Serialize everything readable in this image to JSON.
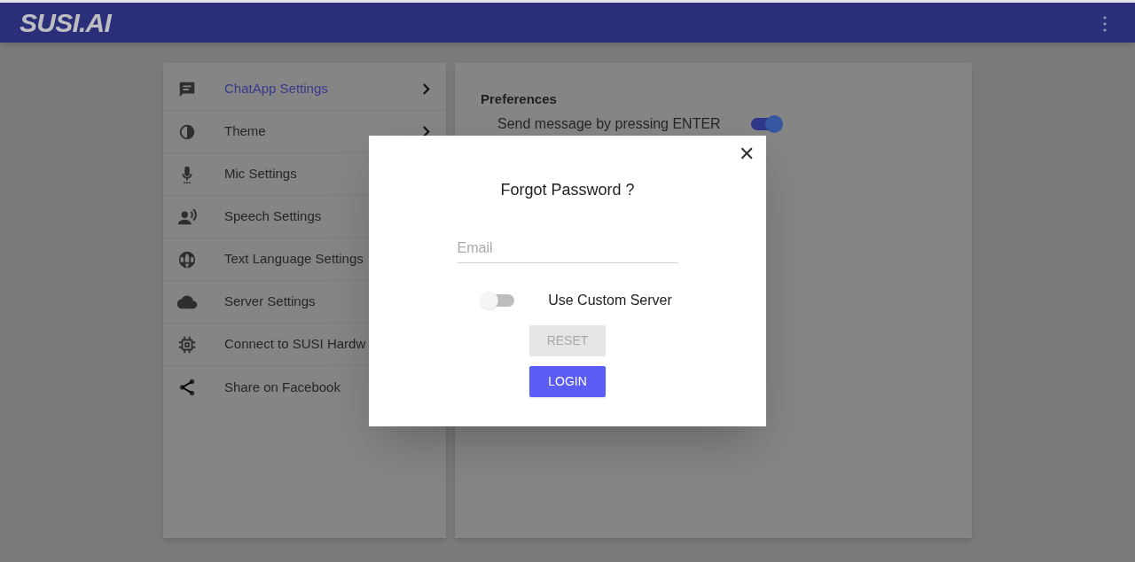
{
  "header": {
    "logo": "SUSI.AI",
    "menu_icon": "⋮"
  },
  "sidebar": {
    "items": [
      {
        "label": "ChatApp Settings",
        "selected": true,
        "chevron": true
      },
      {
        "label": "Theme",
        "selected": false,
        "chevron": true
      },
      {
        "label": "Mic Settings",
        "selected": false
      },
      {
        "label": "Speech Settings",
        "selected": false
      },
      {
        "label": "Text Language Settings",
        "selected": false
      },
      {
        "label": "Server Settings",
        "selected": false
      },
      {
        "label": "Connect to SUSI Hardw",
        "selected": false
      },
      {
        "label": "Share on Facebook",
        "selected": false
      }
    ]
  },
  "panel": {
    "title": "Preferences",
    "settings": [
      {
        "label": "Send message by pressing ENTER",
        "on": true
      }
    ]
  },
  "dialog": {
    "title": "Forgot Password ?",
    "close": "✕",
    "email": {
      "placeholder": "Email"
    },
    "custom_server": {
      "label": "Use Custom Server",
      "on": false
    },
    "buttons": [
      {
        "label": "RESET",
        "disabled": true
      },
      {
        "label": "LOGIN",
        "disabled": false
      }
    ]
  }
}
